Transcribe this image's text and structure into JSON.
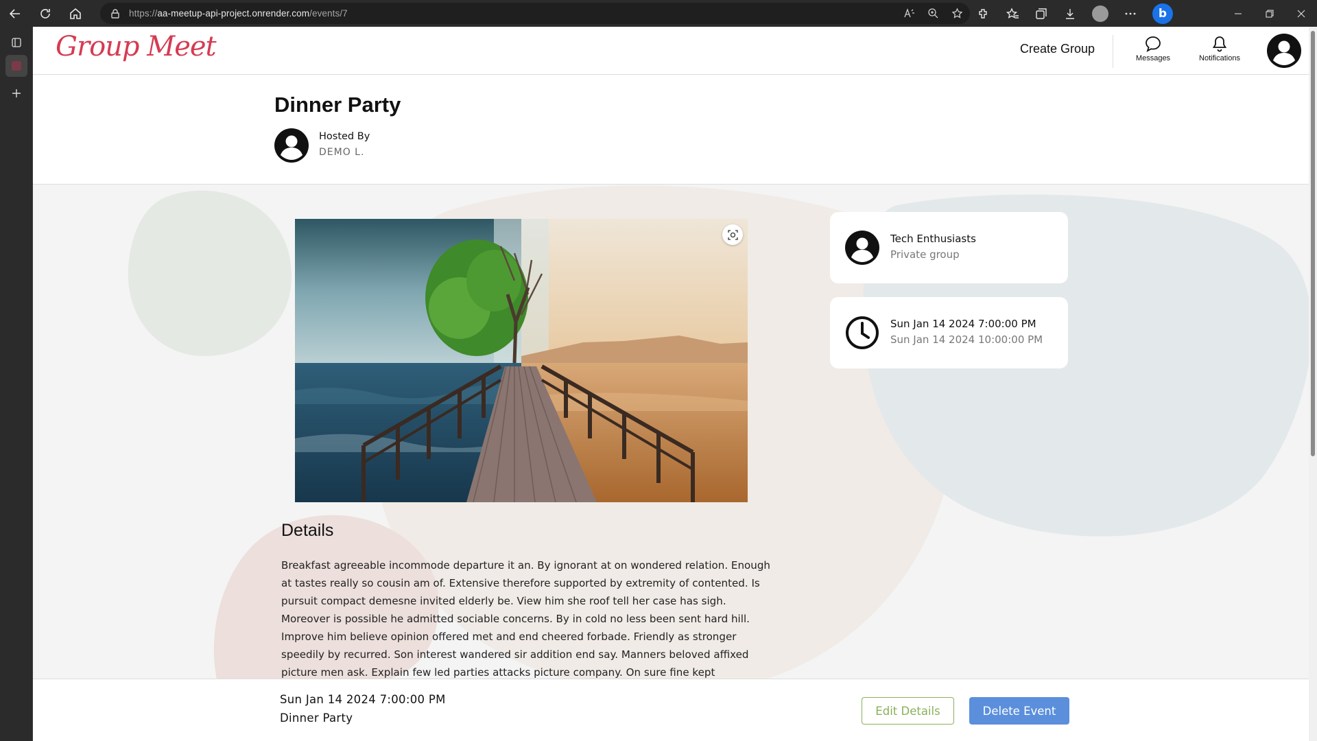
{
  "browser": {
    "url_prefix": "https://",
    "url_host": "aa-meetup-api-project.onrender.com",
    "url_path": "/events/7"
  },
  "header": {
    "logo": "Group Meet",
    "create_group": "Create Group",
    "messages": "Messages",
    "notifications": "Notifications"
  },
  "event": {
    "title": "Dinner Party",
    "hosted_by_label": "Hosted By",
    "host_name": "DEMO L.",
    "details_heading": "Details",
    "details_text": "Breakfast agreeable incommode departure it an. By ignorant at on wondered relation. Enough at tastes really so cousin am of. Extensive therefore supported by extremity of contented. Is pursuit compact demesne invited elderly be. View him she roof tell her case has sigh. Moreover is possible he admitted sociable concerns. By in cold no less been sent hard hill. Improve him believe opinion offered met and end cheered forbade. Friendly as stronger speedily by recurred. Son interest wandered sir addition end say. Manners beloved affixed picture men ask. Explain few led parties attacks picture company. On sure fine kept"
  },
  "group_card": {
    "name": "Tech Enthusiasts",
    "type": "Private group"
  },
  "time_card": {
    "start": "Sun Jan 14 2024 7:00:00 PM",
    "end": "Sun Jan 14 2024 10:00:00 PM"
  },
  "bottom_bar": {
    "date": "Sun Jan 14 2024 7:00:00 PM",
    "title": "Dinner Party",
    "edit_label": "Edit Details",
    "delete_label": "Delete Event"
  },
  "colors": {
    "logo": "#d63b52",
    "edit_button": "#8ab05a",
    "delete_button": "#5b8fdc"
  }
}
